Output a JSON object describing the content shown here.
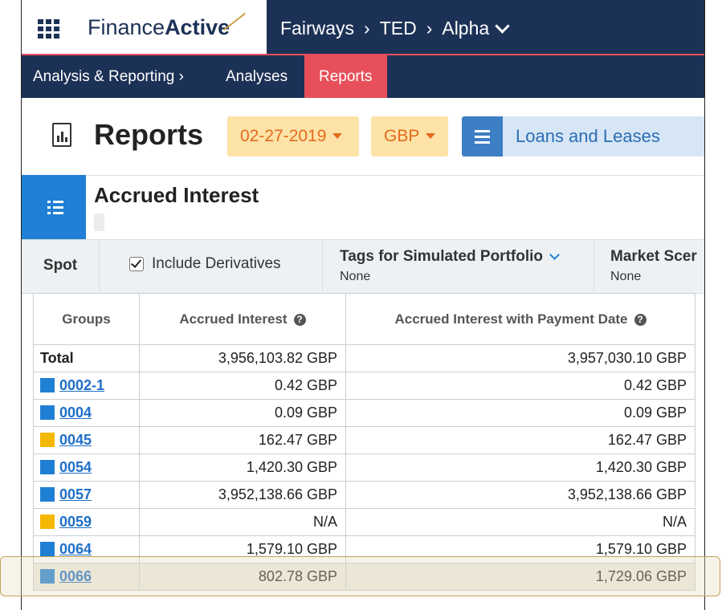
{
  "topbar": {
    "brand_light": "Finance",
    "brand_bold": "Active",
    "breadcrumb": [
      "Fairways",
      "TED",
      "Alpha"
    ]
  },
  "nav": {
    "section": "Analysis & Reporting",
    "items": [
      "Analyses",
      "Reports"
    ]
  },
  "header": {
    "title": "Reports",
    "date": "02-27-2019",
    "currency": "GBP",
    "portfolio": "Loans and Leases"
  },
  "analysis": {
    "title": "Accrued Interest"
  },
  "filters": {
    "spot": "Spot",
    "include_derivatives": "Include Derivatives",
    "tags_label": "Tags for Simulated Portfolio",
    "tags_value": "None",
    "market_label": "Market Scer",
    "market_value": "None"
  },
  "table": {
    "headers": [
      "Groups",
      "Accrued Interest",
      "Accrued Interest with Payment Date"
    ],
    "total": {
      "group": "Total",
      "accrued": "3,956,103.82 GBP",
      "with_payment": "3,957,030.10 GBP"
    },
    "rows": [
      {
        "group": "0002-1",
        "color": "#1f7fd4",
        "accrued": "0.42 GBP",
        "with_payment": "0.42 GBP"
      },
      {
        "group": "0004",
        "color": "#1f7fd4",
        "accrued": "0.09 GBP",
        "with_payment": "0.09 GBP"
      },
      {
        "group": "0045",
        "color": "#f5b800",
        "accrued": "162.47 GBP",
        "with_payment": "162.47 GBP"
      },
      {
        "group": "0054",
        "color": "#1f7fd4",
        "accrued": "1,420.30 GBP",
        "with_payment": "1,420.30 GBP"
      },
      {
        "group": "0057",
        "color": "#1f7fd4",
        "accrued": "3,952,138.66 GBP",
        "with_payment": "3,952,138.66 GBP"
      },
      {
        "group": "0059",
        "color": "#f5b800",
        "accrued": "N/A",
        "with_payment": "N/A"
      },
      {
        "group": "0064",
        "color": "#1f7fd4",
        "accrued": "1,579.10 GBP",
        "with_payment": "1,579.10 GBP"
      },
      {
        "group": "0066",
        "color": "#1f7fd4",
        "accrued": "802.78 GBP",
        "with_payment": "1,729.06 GBP"
      }
    ]
  }
}
